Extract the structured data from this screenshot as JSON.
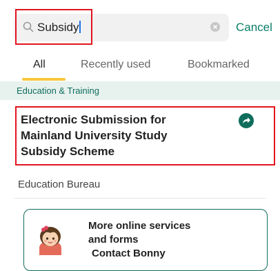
{
  "search": {
    "query": "Subsidy",
    "icon": "search-icon",
    "clear_icon": "clear-icon",
    "cancel_label": "Cancel"
  },
  "tabs": [
    {
      "label": "All",
      "active": true
    },
    {
      "label": "Recently used",
      "active": false
    },
    {
      "label": "Bookmarked",
      "active": false
    }
  ],
  "category": "Education & Training",
  "result": {
    "title": "Electronic Submission for Mainland University Study Subsidy Scheme",
    "action_icon": "share-arrow-icon"
  },
  "department": "Education Bureau",
  "more": {
    "line1": "More online services",
    "line2": "and forms",
    "contact": "Contact Bonny"
  },
  "colors": {
    "accent": "#0c7d68",
    "tab_underline": "#f6c63c",
    "highlight": "#e0141e",
    "category_bg": "#e7f1ee"
  }
}
